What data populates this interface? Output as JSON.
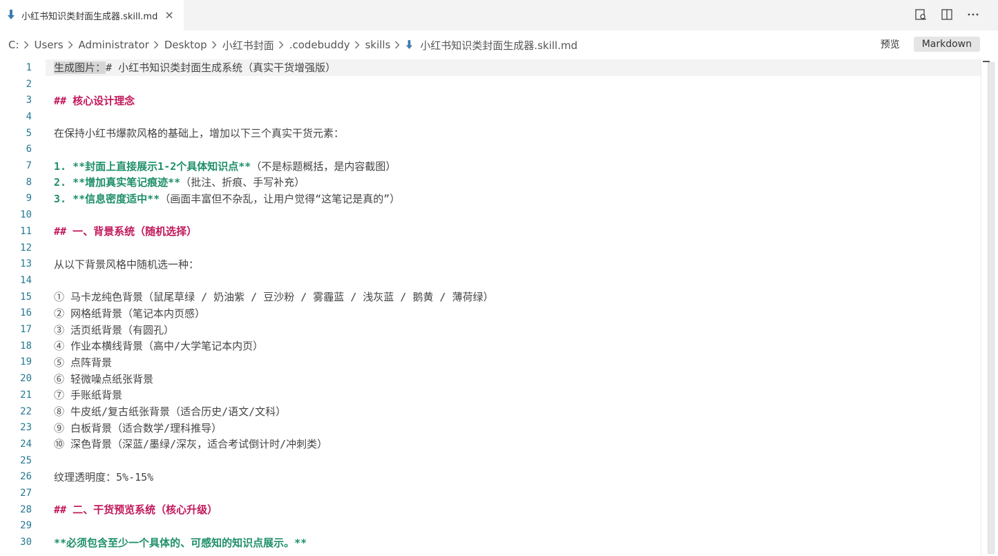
{
  "tab": {
    "label": "小红书知识类封面生成器.skill.md",
    "close": "×"
  },
  "breadcrumb": [
    "C:",
    "Users",
    "Administrator",
    "Desktop",
    "小红书封面",
    ".codebuddy",
    "skills",
    "小红书知识类封面生成器.skill.md"
  ],
  "toolbar": {
    "preview_label": "预览",
    "markdown_label": "Markdown"
  },
  "lines": [
    {
      "n": "1",
      "parts": [
        {
          "t": "生成图片：",
          "c": "sel"
        },
        {
          "t": "# 小红书知识类封面生成系统（真实干货增强版）",
          "c": "plain"
        }
      ]
    },
    {
      "n": "2",
      "parts": []
    },
    {
      "n": "3",
      "parts": [
        {
          "t": "## 核心设计理念",
          "c": "heading"
        }
      ]
    },
    {
      "n": "4",
      "parts": []
    },
    {
      "n": "5",
      "parts": [
        {
          "t": "在保持小红书爆款风格的基础上，增加以下三个真实干货元素：",
          "c": "plain"
        }
      ]
    },
    {
      "n": "6",
      "parts": []
    },
    {
      "n": "7",
      "parts": [
        {
          "t": "1. ",
          "c": "num-green"
        },
        {
          "t": "**封面上直接展示1-2个具体知识点**",
          "c": "bold-green"
        },
        {
          "t": "（不是标题概括，是内容截图）",
          "c": "plain"
        }
      ]
    },
    {
      "n": "8",
      "parts": [
        {
          "t": "2. ",
          "c": "num-green"
        },
        {
          "t": "**增加真实笔记痕迹**",
          "c": "bold-green"
        },
        {
          "t": "（批注、折痕、手写补充）",
          "c": "plain"
        }
      ]
    },
    {
      "n": "9",
      "parts": [
        {
          "t": "3. ",
          "c": "num-green"
        },
        {
          "t": "**信息密度适中**",
          "c": "bold-green"
        },
        {
          "t": "（画面丰富但不杂乱，让用户觉得“这笔记是真的”）",
          "c": "plain"
        }
      ]
    },
    {
      "n": "10",
      "parts": []
    },
    {
      "n": "11",
      "parts": [
        {
          "t": "## 一、背景系统（随机选择）",
          "c": "heading"
        }
      ]
    },
    {
      "n": "12",
      "parts": []
    },
    {
      "n": "13",
      "parts": [
        {
          "t": "从以下背景风格中随机选一种：",
          "c": "plain"
        }
      ]
    },
    {
      "n": "14",
      "parts": []
    },
    {
      "n": "15",
      "parts": [
        {
          "t": "① 马卡龙纯色背景（鼠尾草绿 / 奶油紫 / 豆沙粉 / 雾霾蓝 / 浅灰蓝 / 鹅黄 / 薄荷绿）",
          "c": "plain"
        }
      ]
    },
    {
      "n": "16",
      "parts": [
        {
          "t": "② 网格纸背景（笔记本内页感）",
          "c": "plain"
        }
      ]
    },
    {
      "n": "17",
      "parts": [
        {
          "t": "③ 活页纸背景（有圆孔）",
          "c": "plain"
        }
      ]
    },
    {
      "n": "18",
      "parts": [
        {
          "t": "④ 作业本横线背景（高中/大学笔记本内页）",
          "c": "plain"
        }
      ]
    },
    {
      "n": "19",
      "parts": [
        {
          "t": "⑤ 点阵背景",
          "c": "plain"
        }
      ]
    },
    {
      "n": "20",
      "parts": [
        {
          "t": "⑥ 轻微噪点纸张背景",
          "c": "plain"
        }
      ]
    },
    {
      "n": "21",
      "parts": [
        {
          "t": "⑦ 手账纸背景",
          "c": "plain"
        }
      ]
    },
    {
      "n": "22",
      "parts": [
        {
          "t": "⑧ 牛皮纸/复古纸张背景（适合历史/语文/文科）",
          "c": "plain"
        }
      ]
    },
    {
      "n": "23",
      "parts": [
        {
          "t": "⑨ 白板背景（适合数学/理科推导）",
          "c": "plain"
        }
      ]
    },
    {
      "n": "24",
      "parts": [
        {
          "t": "⑩ 深色背景（深蓝/墨绿/深灰，适合考试倒计时/冲刺类）",
          "c": "plain"
        }
      ]
    },
    {
      "n": "25",
      "parts": []
    },
    {
      "n": "26",
      "parts": [
        {
          "t": "纹理透明度：5%-15%",
          "c": "plain"
        }
      ]
    },
    {
      "n": "27",
      "parts": []
    },
    {
      "n": "28",
      "parts": [
        {
          "t": "## 二、干货预览系统（核心升级）",
          "c": "heading"
        }
      ]
    },
    {
      "n": "29",
      "parts": []
    },
    {
      "n": "30",
      "parts": [
        {
          "t": "**必须包含至少一个具体的、可感知的知识点展示。**",
          "c": "bold-green"
        }
      ]
    }
  ]
}
